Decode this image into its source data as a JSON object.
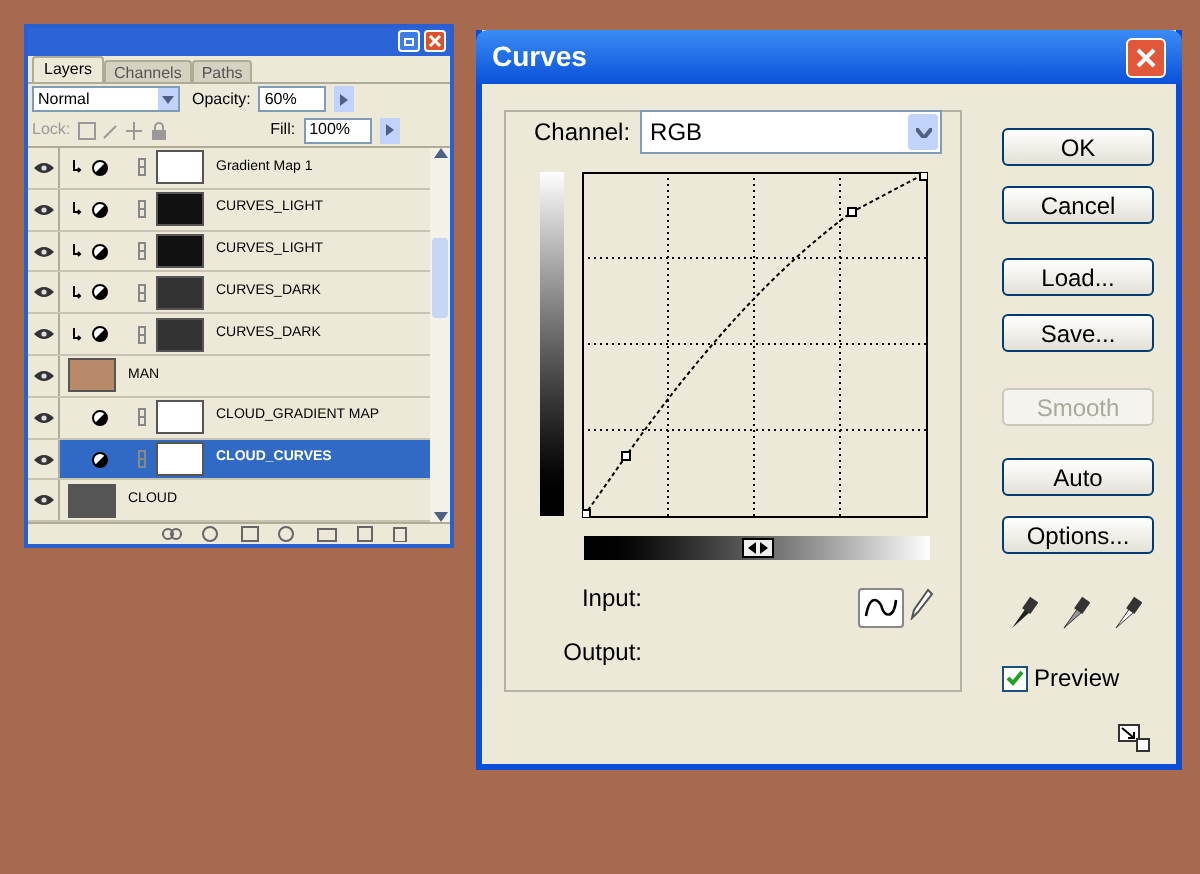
{
  "layers_panel": {
    "tabs": [
      {
        "label": "Layers",
        "selected": true
      },
      {
        "label": "Channels",
        "selected": false
      },
      {
        "label": "Paths",
        "selected": false
      }
    ],
    "blend_mode": "Normal",
    "opacity_label": "Opacity:",
    "opacity": "60%",
    "lock_label": "Lock:",
    "fill_label": "Fill:",
    "fill": "100%",
    "layers": [
      {
        "name": "Gradient Map 1",
        "kind": "adjustment",
        "clipped": true,
        "color": "#ffffff",
        "selected": false
      },
      {
        "name": "CURVES_LIGHT",
        "kind": "adjustment",
        "clipped": true,
        "color": "#111111",
        "selected": false
      },
      {
        "name": "CURVES_LIGHT",
        "kind": "adjustment",
        "clipped": true,
        "color": "#111111",
        "selected": false
      },
      {
        "name": "CURVES_DARK",
        "kind": "adjustment",
        "clipped": true,
        "color": "#333333",
        "selected": false
      },
      {
        "name": "CURVES_DARK",
        "kind": "adjustment",
        "clipped": true,
        "color": "#333333",
        "selected": false
      },
      {
        "name": "MAN",
        "kind": "pixel",
        "clipped": false,
        "color": "#b88a6a",
        "selected": false
      },
      {
        "name": "CLOUD_GRADIENT MAP",
        "kind": "adjustment",
        "clipped": false,
        "color": "#ffffff",
        "selected": false
      },
      {
        "name": "CLOUD_CURVES",
        "kind": "adjustment",
        "clipped": false,
        "color": "#ffffff",
        "selected": true
      },
      {
        "name": "CLOUD",
        "kind": "pixel",
        "clipped": false,
        "color": "#555555",
        "selected": false
      }
    ]
  },
  "curves_dialog": {
    "title": "Curves",
    "channel_label": "Channel:",
    "channel": "RGB",
    "buttons": [
      {
        "label": "OK",
        "disabled": false
      },
      {
        "label": "Cancel",
        "disabled": false
      },
      {
        "label": "Load...",
        "disabled": false
      },
      {
        "label": "Save...",
        "disabled": false
      },
      {
        "label": "Smooth",
        "disabled": true
      },
      {
        "label": "Auto",
        "disabled": false
      },
      {
        "label": "Options...",
        "disabled": false
      }
    ],
    "input_label": "Input:",
    "output_label": "Output:",
    "preview": {
      "label": "Preview",
      "checked": true
    }
  }
}
